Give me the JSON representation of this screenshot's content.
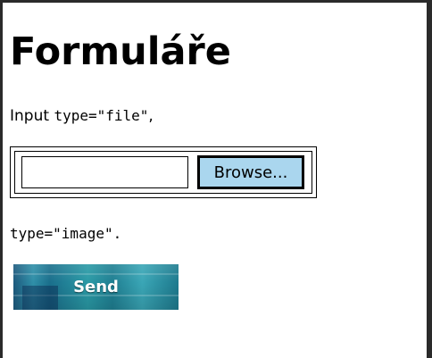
{
  "page": {
    "title": "Formuláře"
  },
  "intro": {
    "prefix": "Input ",
    "code": "type=\"file\"",
    "suffix": ","
  },
  "file_input": {
    "value": "",
    "browse_label": "Browse..."
  },
  "image_note": {
    "code": "type=\"image\"",
    "suffix": "."
  },
  "image_button": {
    "label": "Send"
  },
  "colors": {
    "browse_button_bg": "#aad6ee",
    "send_button_teal": "#2a9aa6",
    "frame": "#2a2a2a"
  }
}
